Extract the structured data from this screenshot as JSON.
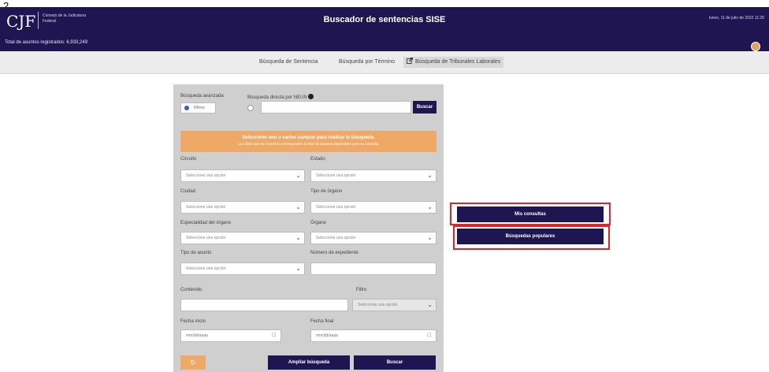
{
  "page_number": "2",
  "header": {
    "logo_mark": "CJF",
    "logo_text": "Consejo de la Judicatura Federal",
    "title": "Buscador de sentencias SISE",
    "date": "lunes, 11 de julio de 2022 11:26",
    "total_label": "Total de asuntos registrados: 6,933,249"
  },
  "tabs": [
    {
      "label": "Búsqueda de Sentencia"
    },
    {
      "label": "Búsqueda por Término"
    },
    {
      "label": "Búsqueda de Tribunales Laborales"
    }
  ],
  "form": {
    "advanced_label": "Búsqueda avanzada",
    "neun_label": "Búsqueda directa por NEUN",
    "filtros_label": "Filtros",
    "search_button": "Buscar",
    "banner_title": "Seleccione uno o varios campos para realizar la búsqueda.",
    "banner_sub": "Las cifras que se muestran corresponden al total de asuntos disponibles para su consulta.",
    "select_placeholder": "Seleccione una opción",
    "date_placeholder": "mm/dd/aaaa",
    "fields": {
      "circuito": "Circuito",
      "estado": "Estado",
      "ciudad": "Ciudad",
      "tipo_organo": "Tipo de órgano",
      "especialidad": "Especialidad del órgano",
      "organo": "Órgano",
      "tipo_asunto": "Tipo de asunto",
      "numero_expediente": "Número de expediente",
      "contenido": "Contenido",
      "filtro": "Filtro",
      "fecha_inicio": "Fecha inicio",
      "fecha_final": "Fecha final"
    },
    "ampliar_button": "Ampliar búsqueda",
    "buscar_button": "Buscar",
    "reset_icon": "reset-icon"
  },
  "side": {
    "mis_consultas": "Mis consultas",
    "busquedas_populares": "Búsquedas populares"
  },
  "colors": {
    "brand": "#1f1550",
    "accent": "#efa865",
    "highlight": "#e0242b"
  }
}
